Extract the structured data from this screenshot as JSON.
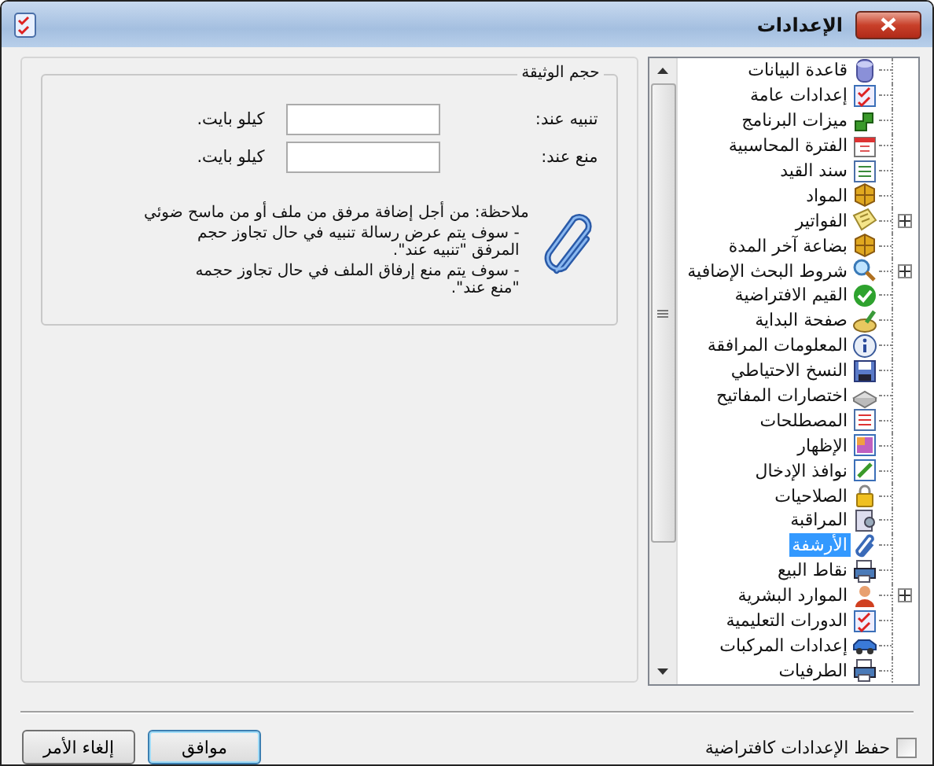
{
  "window": {
    "title": "الإعدادات"
  },
  "tree": {
    "items": [
      {
        "label": "قاعدة البيانات",
        "selected": false,
        "expandable": false
      },
      {
        "label": "إعدادات عامة",
        "selected": false,
        "expandable": false
      },
      {
        "label": "ميزات البرنامج",
        "selected": false,
        "expandable": false
      },
      {
        "label": "الفترة المحاسبية",
        "selected": false,
        "expandable": false
      },
      {
        "label": "سند القيد",
        "selected": false,
        "expandable": false
      },
      {
        "label": "المواد",
        "selected": false,
        "expandable": false
      },
      {
        "label": "الفواتير",
        "selected": false,
        "expandable": true,
        "expanded": false
      },
      {
        "label": "بضاعة آخر المدة",
        "selected": false,
        "expandable": false
      },
      {
        "label": "شروط البحث الإضافية",
        "selected": false,
        "expandable": true,
        "expanded": false
      },
      {
        "label": "القيم الافتراضية",
        "selected": false,
        "expandable": false
      },
      {
        "label": "صفحة البداية",
        "selected": false,
        "expandable": false
      },
      {
        "label": "المعلومات المرافقة",
        "selected": false,
        "expandable": false
      },
      {
        "label": "النسخ الاحتياطي",
        "selected": false,
        "expandable": false
      },
      {
        "label": "اختصارات المفاتيح",
        "selected": false,
        "expandable": false
      },
      {
        "label": "المصطلحات",
        "selected": false,
        "expandable": false
      },
      {
        "label": "الإظهار",
        "selected": false,
        "expandable": false
      },
      {
        "label": "نوافذ الإدخال",
        "selected": false,
        "expandable": false
      },
      {
        "label": "الصلاحيات",
        "selected": false,
        "expandable": false
      },
      {
        "label": "المراقبة",
        "selected": false,
        "expandable": false
      },
      {
        "label": "الأرشفة",
        "selected": true,
        "expandable": false
      },
      {
        "label": "نقاط البيع",
        "selected": false,
        "expandable": false
      },
      {
        "label": "الموارد البشرية",
        "selected": false,
        "expandable": true,
        "expanded": false
      },
      {
        "label": "الدورات التعليمية",
        "selected": false,
        "expandable": false
      },
      {
        "label": "إعدادات المركبات",
        "selected": false,
        "expandable": false
      },
      {
        "label": "الطرفيات",
        "selected": false,
        "expandable": false
      }
    ]
  },
  "group": {
    "title": "حجم الوثيقة",
    "fields": [
      {
        "label": "تنبيه عند:",
        "unit": "كيلو بايت."
      },
      {
        "label": "منع عند:",
        "unit": "كيلو بايت."
      }
    ],
    "note": "ملاحظة: من أجل إضافة مرفق من ملف أو من ماسح ضوئي",
    "bullets": [
      "- سوف يتم عرض رسالة تنبيه في حال تجاوز حجم المرفق \"تنبيه عند\".",
      "- سوف يتم منع إرفاق الملف في حال تجاوز حجمه \"منع عند\"."
    ]
  },
  "save_default": {
    "label": "حفظ الإعدادات كافتراضية",
    "checked": false
  },
  "buttons": [
    {
      "label": "موافق",
      "default": true
    },
    {
      "label": "إلغاء الأمر",
      "default": false
    }
  ]
}
